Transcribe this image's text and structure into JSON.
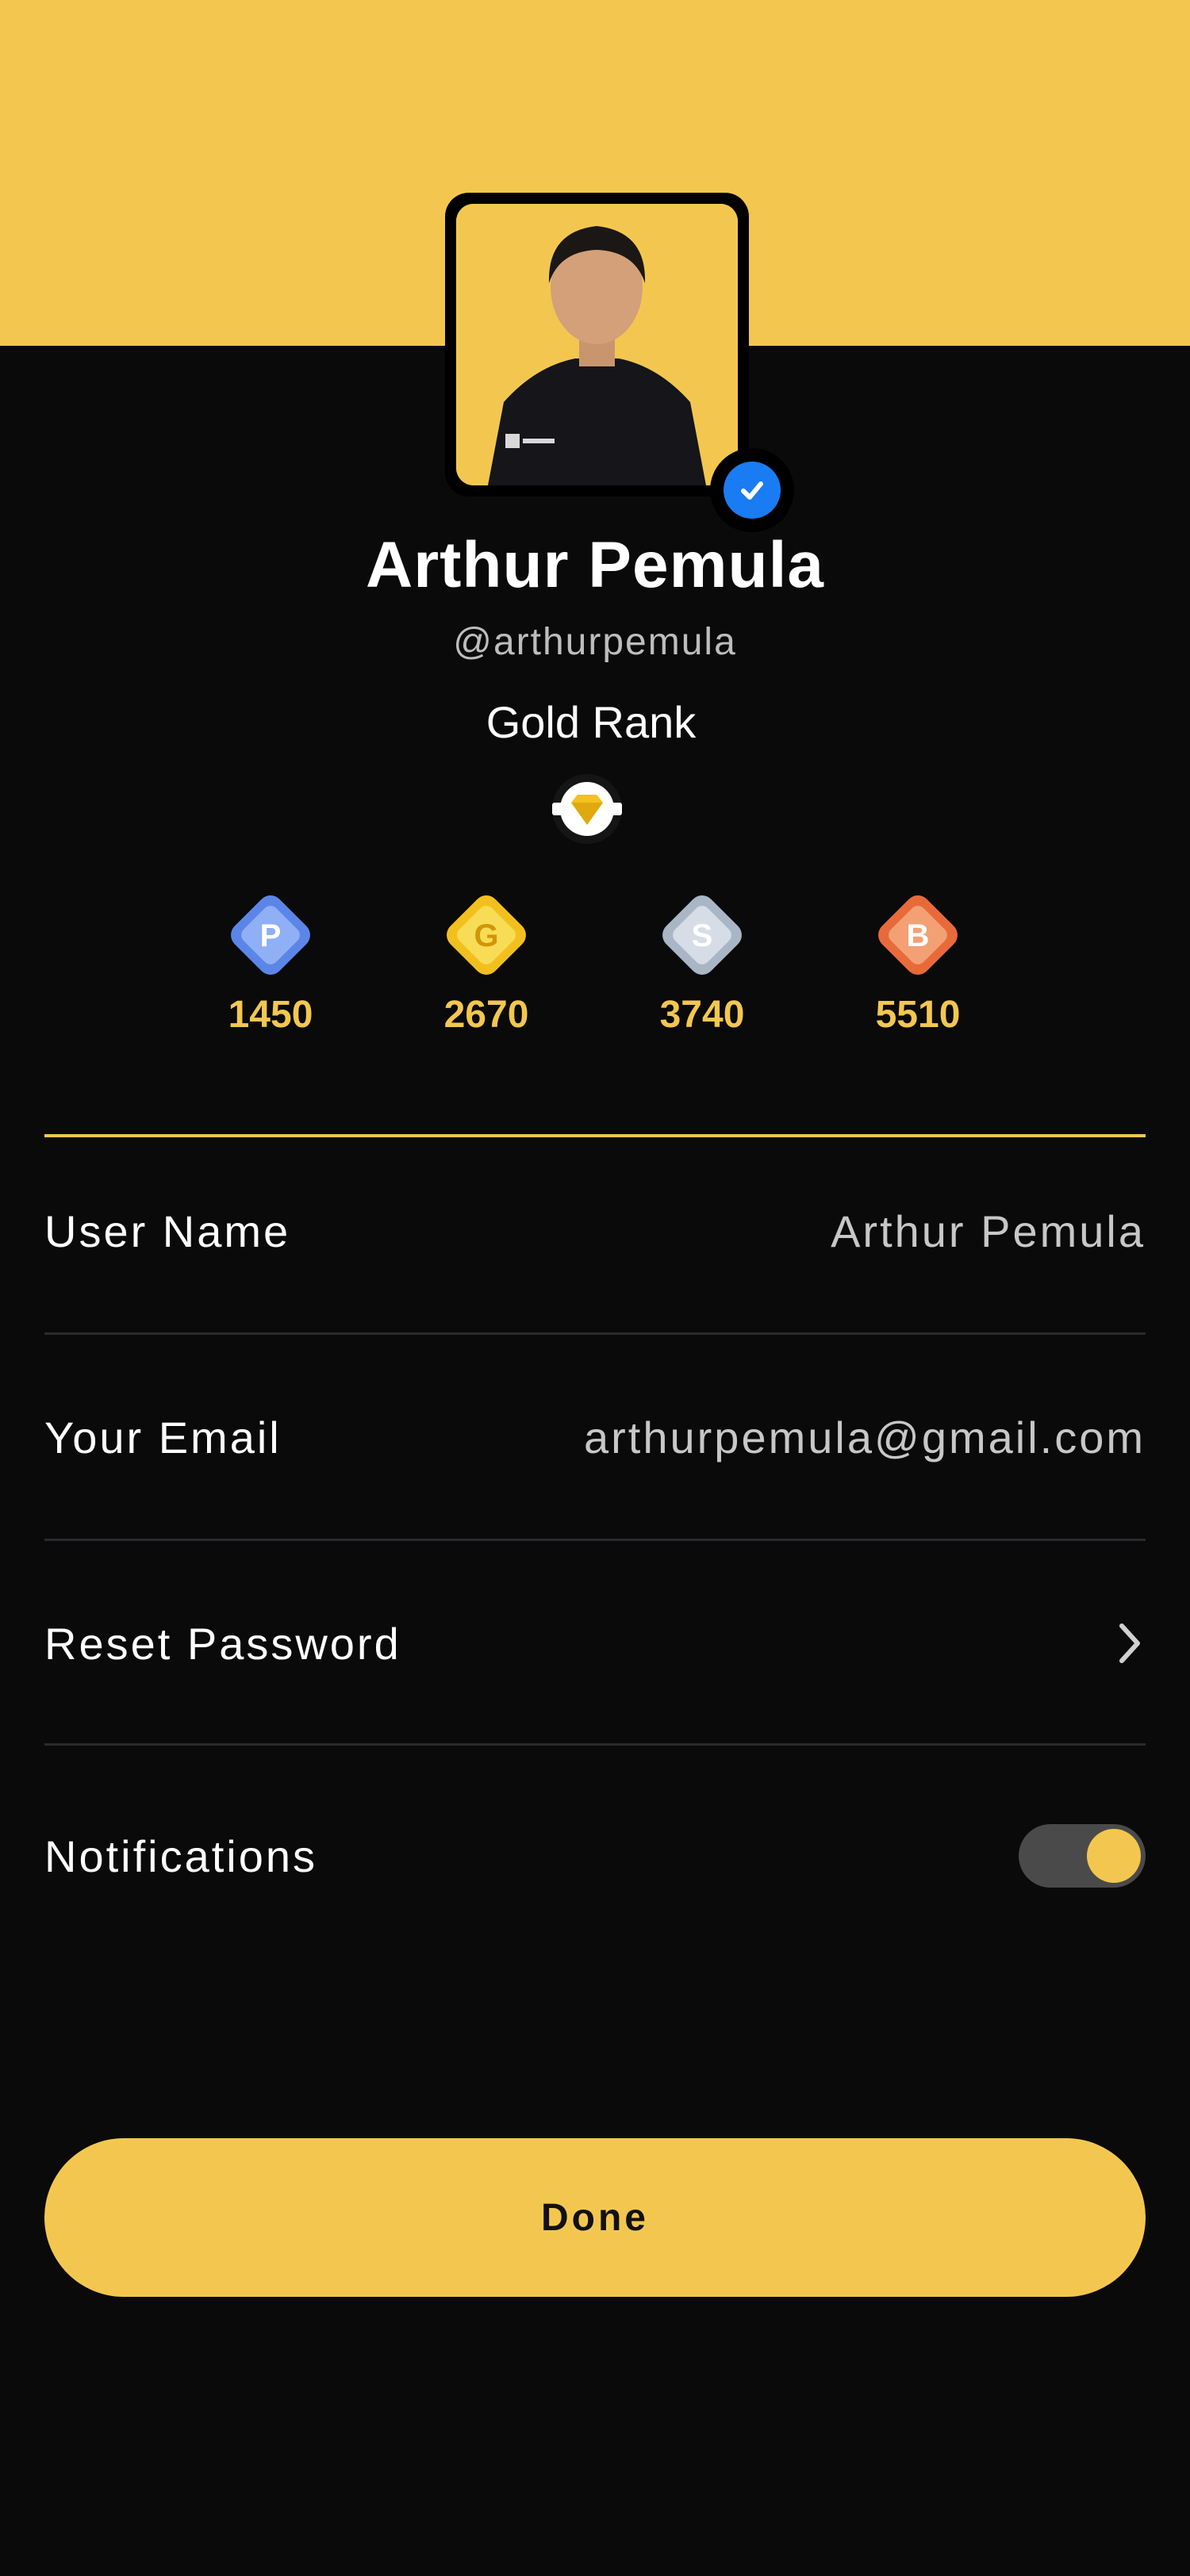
{
  "profile": {
    "name": "Arthur Pemula",
    "handle": "@arthurpemula",
    "rank": "Gold Rank",
    "verified": true
  },
  "badges": [
    {
      "letter": "P",
      "value": "1450",
      "color": "#5b86e8"
    },
    {
      "letter": "G",
      "value": "2670",
      "color": "#f2c01e"
    },
    {
      "letter": "S",
      "value": "3740",
      "color": "#a9b6c6"
    },
    {
      "letter": "B",
      "value": "5510",
      "color": "#e86a3a"
    }
  ],
  "settings": {
    "username_label": "User Name",
    "username_value": "Arthur Pemula",
    "email_label": "Your Email",
    "email_value": "arthurpemula@gmail.com",
    "reset_label": "Reset Password",
    "notifications_label": "Notifications",
    "notifications_on": true
  },
  "done_label": "Done",
  "colors": {
    "accent": "#f3c74f",
    "background": "#0a0a0a",
    "verified": "#1a7cf2"
  }
}
